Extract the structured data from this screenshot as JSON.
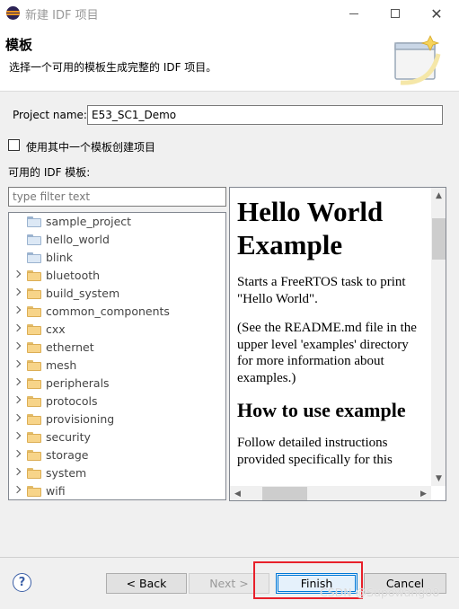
{
  "window": {
    "title": "新建 IDF 项目"
  },
  "header": {
    "title": "模板",
    "description": "选择一个可用的模板生成完整的 IDF 项目。"
  },
  "project": {
    "label": "Project name:",
    "value": "E53_SC1_Demo"
  },
  "use_template": {
    "label": "使用其中一个模板创建项目",
    "checked": false
  },
  "templates": {
    "label": "可用的 IDF 模板:",
    "filter_placeholder": "type filter text",
    "items": [
      {
        "label": "sample_project",
        "expandable": false,
        "kind": "project"
      },
      {
        "label": "hello_world",
        "expandable": false,
        "kind": "project"
      },
      {
        "label": "blink",
        "expandable": false,
        "kind": "project"
      },
      {
        "label": "bluetooth",
        "expandable": true,
        "kind": "folder"
      },
      {
        "label": "build_system",
        "expandable": true,
        "kind": "folder"
      },
      {
        "label": "common_components",
        "expandable": true,
        "kind": "folder"
      },
      {
        "label": "cxx",
        "expandable": true,
        "kind": "folder"
      },
      {
        "label": "ethernet",
        "expandable": true,
        "kind": "folder"
      },
      {
        "label": "mesh",
        "expandable": true,
        "kind": "folder"
      },
      {
        "label": "peripherals",
        "expandable": true,
        "kind": "folder"
      },
      {
        "label": "protocols",
        "expandable": true,
        "kind": "folder"
      },
      {
        "label": "provisioning",
        "expandable": true,
        "kind": "folder"
      },
      {
        "label": "security",
        "expandable": true,
        "kind": "folder"
      },
      {
        "label": "storage",
        "expandable": true,
        "kind": "folder"
      },
      {
        "label": "system",
        "expandable": true,
        "kind": "folder"
      },
      {
        "label": "wifi",
        "expandable": true,
        "kind": "folder"
      }
    ]
  },
  "readme": {
    "title": "Hello World Example",
    "para1": "Starts a FreeRTOS task to print \"Hello World\".",
    "para2": "(See the README.md file in the upper level 'examples' directory for more information about examples.)",
    "heading2": "How to use example",
    "para3": "Follow detailed instructions provided specifically for this"
  },
  "buttons": {
    "back": "< Back",
    "next": "Next >",
    "finish": "Finish",
    "cancel": "Cancel",
    "help": "?"
  },
  "watermark": "CSDN @Supowang08",
  "colors": {
    "highlight_box": "#e8202a",
    "finish_border": "#0078d7"
  }
}
